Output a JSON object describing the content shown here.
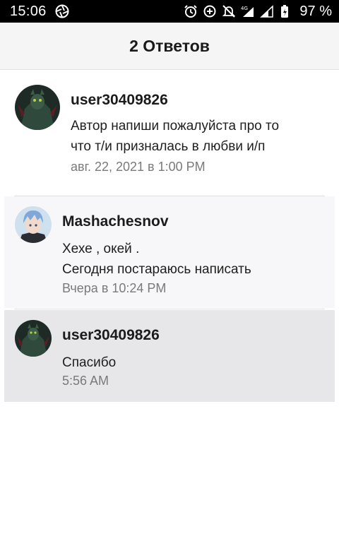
{
  "status_bar": {
    "time": "15:06",
    "battery": "97 %",
    "network": "4G"
  },
  "header": {
    "title": "2 Ответов"
  },
  "replies": [
    {
      "username": "user30409826",
      "lines": [
        "Автор напиши пожалуйста про то",
        "что т/и призналась в любви и/п"
      ],
      "time": "авг. 22, 2021 в 1:00 PM"
    },
    {
      "username": "Mashachesnov",
      "lines": [
        "Хехе , окей .",
        "Сегодня постараюсь написать"
      ],
      "time": "Вчера в 10:24 PM"
    },
    {
      "username": "user30409826",
      "lines": [
        "Спасибо"
      ],
      "time": "5:56 AM"
    }
  ],
  "colors": {
    "status_bar_bg": "#000000",
    "header_bg": "#f5f5f5",
    "selected_row_bg": "#e7e6e8",
    "secondary_text": "#7a7a7a"
  }
}
